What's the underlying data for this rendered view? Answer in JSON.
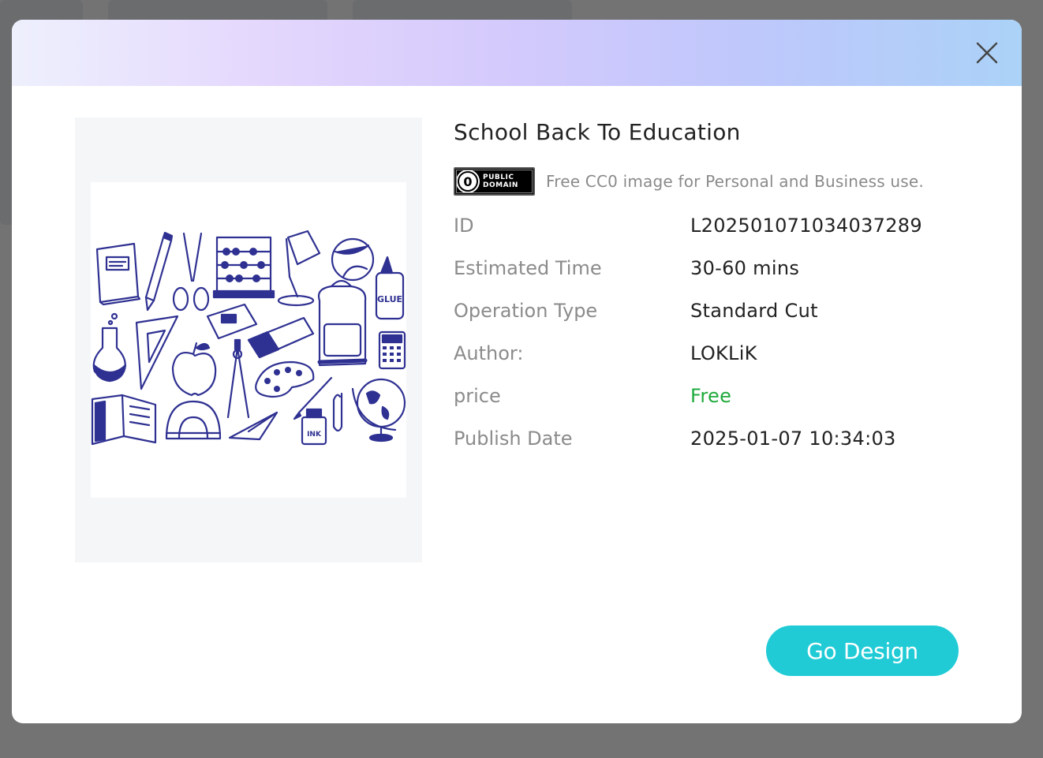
{
  "product": {
    "title": "School Back To Education",
    "license_badge": "PUBLIC DOMAIN",
    "license_text": "Free CC0 image for Personal and Business use."
  },
  "details": [
    {
      "label": "ID",
      "value": "L202501071034037289"
    },
    {
      "label": "Estimated Time",
      "value": "30-60 mins"
    },
    {
      "label": "Operation Type",
      "value": "Standard Cut"
    },
    {
      "label": "Author:",
      "value": "LOKLiK"
    },
    {
      "label": "price",
      "value": "Free"
    },
    {
      "label": "Publish Date",
      "value": "2025-01-07 10:34:03"
    }
  ],
  "illustration_labels": {
    "glue": "GLUE",
    "ink": "INK"
  },
  "actions": {
    "go_design": "Go Design"
  },
  "colors": {
    "accent": "#20cbd6",
    "free": "#1faa3c",
    "illustration": "#2f3192"
  },
  "icons": {
    "close": "close-icon",
    "license": "public-domain-icon"
  }
}
